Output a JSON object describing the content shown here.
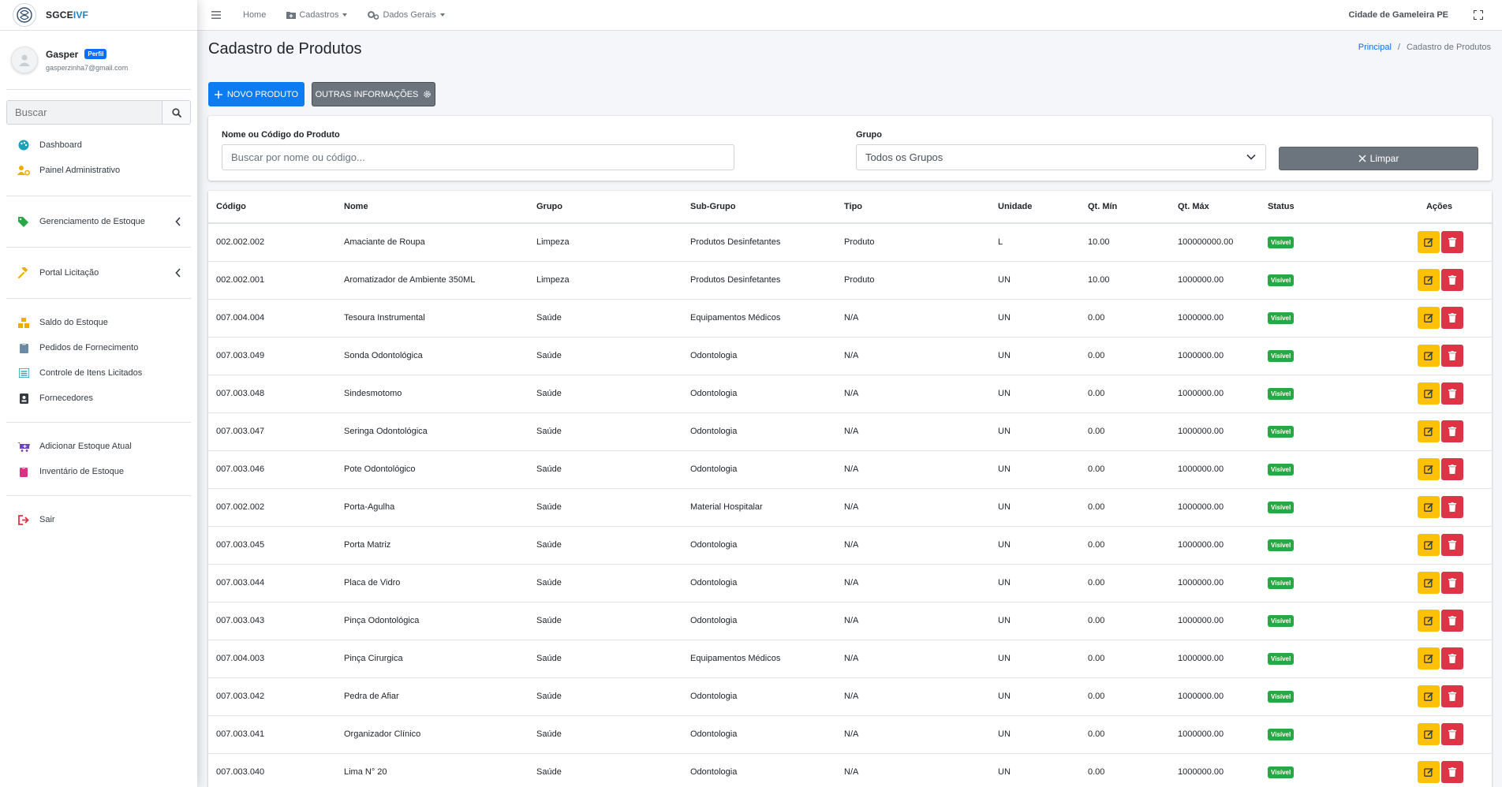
{
  "brand": {
    "name_part1": "SGCE",
    "name_part2": "IVF"
  },
  "user": {
    "name": "Gasper",
    "badge": "Perfil",
    "email": "gasperzinha7@gmail.com"
  },
  "sidebar": {
    "search_placeholder": "Buscar",
    "items": [
      {
        "label": "Dashboard",
        "icon": "palette-icon",
        "color": "#17a2b8"
      },
      {
        "label": "Painel Administrativo",
        "icon": "users-cog-icon",
        "color": "#f0ad00"
      },
      {
        "label": "Gerenciamento de Estoque",
        "icon": "tags-icon",
        "color": "#28a745"
      },
      {
        "label": "Portal Licitação",
        "icon": "gavel-icon",
        "color": "#f0ad00"
      },
      {
        "label": "Saldo do Estoque",
        "icon": "cubes-icon",
        "color": "#f0ad00"
      },
      {
        "label": "Pedidos de Fornecimento",
        "icon": "clipboard-icon",
        "color": "#6c757d"
      },
      {
        "label": "Controle de Itens Licitados",
        "icon": "list-icon",
        "color": "#17a2b8"
      },
      {
        "label": "Fornecedores",
        "icon": "address-card-icon",
        "color": "#343a40"
      },
      {
        "label": "Adicionar Estoque Atual",
        "icon": "cart-plus-icon",
        "color": "#6f42c1"
      },
      {
        "label": "Inventário de Estoque",
        "icon": "clipboard-list-icon",
        "color": "#d63384"
      },
      {
        "label": "Sair",
        "icon": "sign-out-icon",
        "color": "#dc3545"
      }
    ]
  },
  "topbar": {
    "home": "Home",
    "cadastros": "Cadastros",
    "dados_gerais": "Dados Gerais",
    "city": "Cidade de Gameleira PE"
  },
  "page": {
    "title": "Cadastro de Produtos",
    "breadcrumb_home": "Principal",
    "breadcrumb_current": "Cadastro de Produtos"
  },
  "actions": {
    "new_product": "Novo Produto",
    "other_info": "Outras Informações"
  },
  "filters": {
    "name_label": "Nome ou Código do Produto",
    "name_placeholder": "Buscar por nome ou código...",
    "group_label": "Grupo",
    "group_selected": "Todos os Grupos",
    "clear": "Limpar"
  },
  "table": {
    "headers": [
      "Código",
      "Nome",
      "Grupo",
      "Sub-Grupo",
      "Tipo",
      "Unidade",
      "Qt. Mín",
      "Qt. Máx",
      "Status",
      "Ações"
    ],
    "rows": [
      [
        "002.002.002",
        "Amaciante de Roupa",
        "Limpeza",
        "Produtos Desinfetantes",
        "Produto",
        "L",
        "10.00",
        "100000000.00",
        "Visível"
      ],
      [
        "002.002.001",
        "Aromatizador de Ambiente 350ML",
        "Limpeza",
        "Produtos Desinfetantes",
        "Produto",
        "UN",
        "10.00",
        "1000000.00",
        "Visível"
      ],
      [
        "007.004.004",
        "Tesoura Instrumental",
        "Saúde",
        "Equipamentos Médicos",
        "N/A",
        "UN",
        "0.00",
        "1000000.00",
        "Visível"
      ],
      [
        "007.003.049",
        "Sonda Odontológica",
        "Saúde",
        "Odontologia",
        "N/A",
        "UN",
        "0.00",
        "1000000.00",
        "Visível"
      ],
      [
        "007.003.048",
        "Sindesmotomo",
        "Saúde",
        "Odontologia",
        "N/A",
        "UN",
        "0.00",
        "1000000.00",
        "Visível"
      ],
      [
        "007.003.047",
        "Seringa Odontológica",
        "Saúde",
        "Odontologia",
        "N/A",
        "UN",
        "0.00",
        "1000000.00",
        "Visível"
      ],
      [
        "007.003.046",
        "Pote Odontológico",
        "Saúde",
        "Odontologia",
        "N/A",
        "UN",
        "0.00",
        "1000000.00",
        "Visível"
      ],
      [
        "007.002.002",
        "Porta-Agulha",
        "Saúde",
        "Material Hospitalar",
        "N/A",
        "UN",
        "0.00",
        "1000000.00",
        "Visível"
      ],
      [
        "007.003.045",
        "Porta Matriz",
        "Saúde",
        "Odontologia",
        "N/A",
        "UN",
        "0.00",
        "1000000.00",
        "Visível"
      ],
      [
        "007.003.044",
        "Placa de Vidro",
        "Saúde",
        "Odontologia",
        "N/A",
        "UN",
        "0.00",
        "1000000.00",
        "Visível"
      ],
      [
        "007.003.043",
        "Pinça Odontológica",
        "Saúde",
        "Odontologia",
        "N/A",
        "UN",
        "0.00",
        "1000000.00",
        "Visível"
      ],
      [
        "007.004.003",
        "Pinça Cirurgica",
        "Saúde",
        "Equipamentos Médicos",
        "N/A",
        "UN",
        "0.00",
        "1000000.00",
        "Visível"
      ],
      [
        "007.003.042",
        "Pedra de Afiar",
        "Saúde",
        "Odontologia",
        "N/A",
        "UN",
        "0.00",
        "1000000.00",
        "Visível"
      ],
      [
        "007.003.041",
        "Organizador Clínico",
        "Saúde",
        "Odontologia",
        "N/A",
        "UN",
        "0.00",
        "1000000.00",
        "Visível"
      ],
      [
        "007.003.040",
        "Lima N° 20",
        "Saúde",
        "Odontologia",
        "N/A",
        "UN",
        "0.00",
        "1000000.00",
        "Visível"
      ]
    ]
  },
  "colors": {
    "primary": "#0d7cf3",
    "secondary": "#6c757d",
    "success": "#28a745",
    "warning": "#ffc107",
    "danger": "#dc3545"
  }
}
